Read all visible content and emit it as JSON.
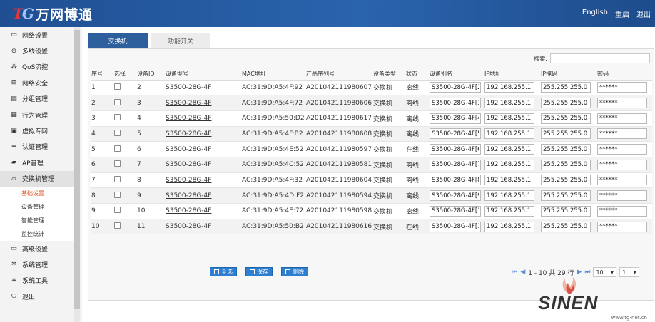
{
  "header": {
    "logo_mark": "TG",
    "brand_name": "万网博通",
    "links": [
      "English",
      "重启",
      "退出"
    ]
  },
  "sidebar": {
    "items": [
      {
        "label": "网络设置",
        "icon": "monitor-icon"
      },
      {
        "label": "多线设置",
        "icon": "crosshair-icon"
      },
      {
        "label": "QoS流控",
        "icon": "qos-icon"
      },
      {
        "label": "网络安全",
        "icon": "network-icon"
      },
      {
        "label": "分组管理",
        "icon": "group-icon"
      },
      {
        "label": "行为管理",
        "icon": "behavior-icon"
      },
      {
        "label": "虚拟专网",
        "icon": "lock-icon"
      },
      {
        "label": "认证管理",
        "icon": "auth-icon"
      },
      {
        "label": "AP管理",
        "icon": "folder-icon"
      },
      {
        "label": "交换机管理",
        "icon": "folder-open-icon"
      }
    ],
    "sub_items": [
      "基础设置",
      "设备管理",
      "智能管理",
      "监控统计"
    ],
    "bottom_items": [
      {
        "label": "高级设置",
        "icon": "monitor-icon"
      },
      {
        "label": "系统管理",
        "icon": "gear-icon"
      },
      {
        "label": "系统工具",
        "icon": "gear-icon"
      },
      {
        "label": "退出",
        "icon": "power-icon"
      }
    ]
  },
  "tabs": [
    {
      "label": "交换机",
      "active": true
    },
    {
      "label": "功能开关",
      "active": false
    }
  ],
  "search": {
    "label": "搜索:",
    "value": ""
  },
  "table": {
    "headers": [
      "序号",
      "选择",
      "设备ID",
      "设备型号",
      "MAC地址",
      "产品序列号",
      "设备类型",
      "状态",
      "设备别名",
      "IP地址",
      "IP掩码",
      "密码"
    ],
    "rows": [
      {
        "no": "1",
        "id": "2",
        "model": "S3500-28G-4F",
        "mac": "AC:31:9D:A5:4F:92",
        "serial": "A201042111980607",
        "type": "交换机",
        "status": "离线",
        "alias": "S3500-28G-4F[2",
        "ip": "192.168.255.1",
        "mask": "255.255.255.0",
        "password": "******"
      },
      {
        "no": "2",
        "id": "3",
        "model": "S3500-28G-4F",
        "mac": "AC:31:9D:A5:4F:72",
        "serial": "A201042111980606",
        "type": "交换机",
        "status": "离线",
        "alias": "S3500-28G-4F[3",
        "ip": "192.168.255.1",
        "mask": "255.255.255.0",
        "password": "******"
      },
      {
        "no": "3",
        "id": "4",
        "model": "S3500-28G-4F",
        "mac": "AC:31:9D:A5:50:D2",
        "serial": "A201042111980617",
        "type": "交换机",
        "status": "离线",
        "alias": "S3500-28G-4F[4",
        "ip": "192.168.255.1",
        "mask": "255.255.255.0",
        "password": "******"
      },
      {
        "no": "4",
        "id": "5",
        "model": "S3500-28G-4F",
        "mac": "AC:31:9D:A5:4F:B2",
        "serial": "A201042111980608",
        "type": "交换机",
        "status": "离线",
        "alias": "S3500-28G-4F[5",
        "ip": "192.168.255.1",
        "mask": "255.255.255.0",
        "password": "******"
      },
      {
        "no": "5",
        "id": "6",
        "model": "S3500-28G-4F",
        "mac": "AC:31:9D:A5:4E:52",
        "serial": "A201042111980597",
        "type": "交换机",
        "status": "在线",
        "alias": "S3500-28G-4F[6",
        "ip": "192.168.255.1",
        "mask": "255.255.255.0",
        "password": "******"
      },
      {
        "no": "6",
        "id": "7",
        "model": "S3500-28G-4F",
        "mac": "AC:31:9D:A5:4C:52",
        "serial": "A201042111980581",
        "type": "交换机",
        "status": "离线",
        "alias": "S3500-28G-4F[7",
        "ip": "192.168.255.1",
        "mask": "255.255.255.0",
        "password": "******"
      },
      {
        "no": "7",
        "id": "8",
        "model": "S3500-28G-4F",
        "mac": "AC:31:9D:A5:4F:32",
        "serial": "A201042111980604",
        "type": "交换机",
        "status": "离线",
        "alias": "S3500-28G-4F[8",
        "ip": "192.168.255.1",
        "mask": "255.255.255.0",
        "password": "******"
      },
      {
        "no": "8",
        "id": "9",
        "model": "S3500-28G-4F",
        "mac": "AC:31:9D:A5:4D:F2",
        "serial": "A201042111980594",
        "type": "交换机",
        "status": "离线",
        "alias": "S3500-28G-4F[9",
        "ip": "192.168.255.1",
        "mask": "255.255.255.0",
        "password": "******"
      },
      {
        "no": "9",
        "id": "10",
        "model": "S3500-28G-4F",
        "mac": "AC:31:9D:A5:4E:72",
        "serial": "A201042111980598",
        "type": "交换机",
        "status": "离线",
        "alias": "S3500-28G-4F[1",
        "ip": "192.168.255.1",
        "mask": "255.255.255.0",
        "password": "******"
      },
      {
        "no": "10",
        "id": "11",
        "model": "S3500-28G-4F",
        "mac": "AC:31:9D:A5:50:B2",
        "serial": "A201042111980616",
        "type": "交换机",
        "status": "在线",
        "alias": "S3500-28G-4F[1",
        "ip": "192.168.255.1",
        "mask": "255.255.255.0",
        "password": "******"
      }
    ]
  },
  "actions": {
    "select_all": "全选",
    "save": "保存",
    "delete": "删除"
  },
  "pager": {
    "range_text": "1 - 10 共 29 行",
    "page_size": "10",
    "page": "1"
  },
  "watermark": {
    "brand": "SINEN",
    "url": "www.tg-net.cn"
  },
  "colors": {
    "header": "#2a64ad",
    "tab_active": "#2d5f9c",
    "button": "#2e7fd0",
    "active_sub": "#e2541b"
  }
}
